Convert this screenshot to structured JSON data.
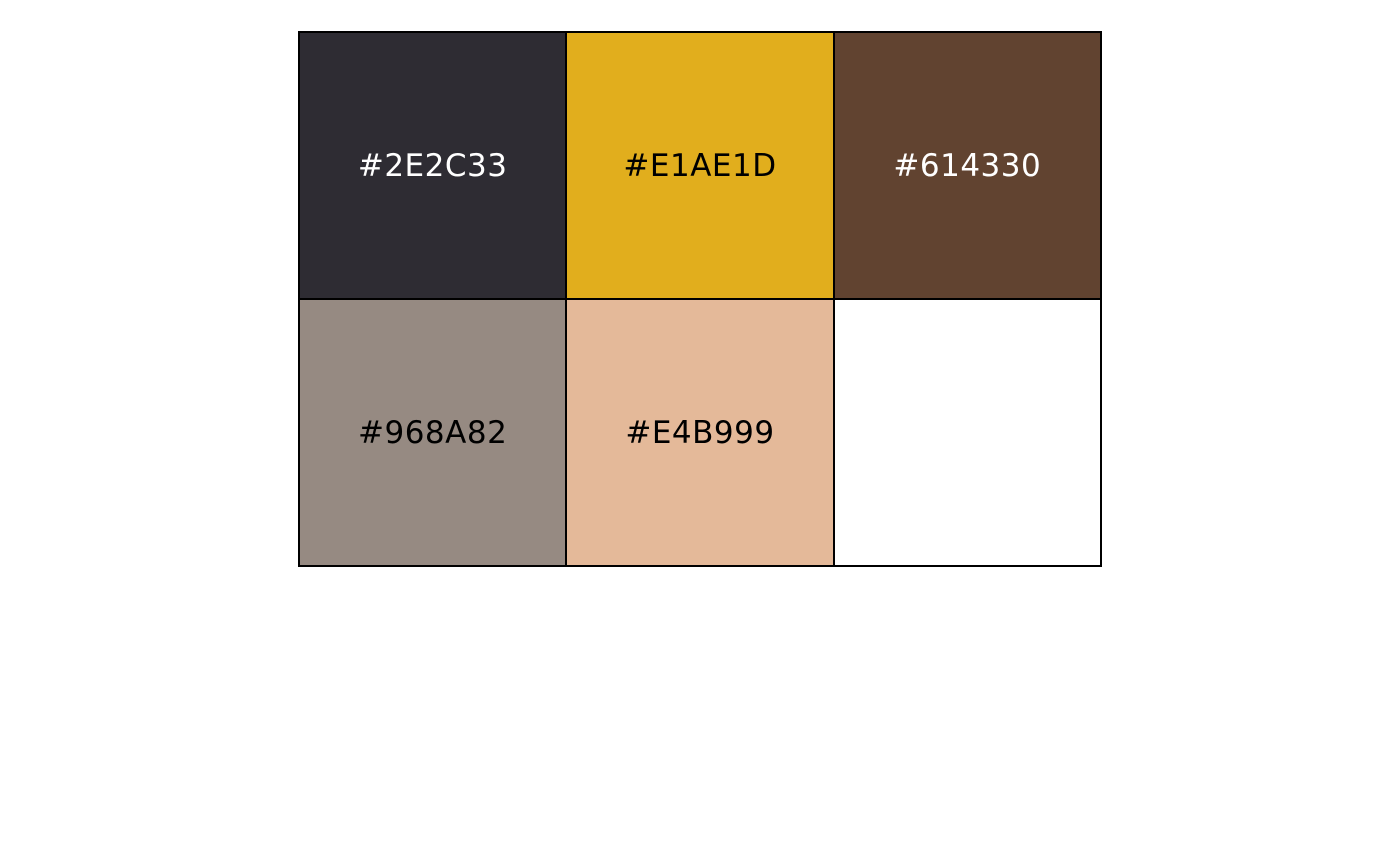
{
  "palette": {
    "swatches": [
      {
        "label": "#2E2C33",
        "color": "#2E2C33",
        "text_color": "#FFFFFF"
      },
      {
        "label": "#E1AE1D",
        "color": "#E1AE1D",
        "text_color": "#000000"
      },
      {
        "label": "#614330",
        "color": "#614330",
        "text_color": "#FFFFFF"
      },
      {
        "label": "#968A82",
        "color": "#968A82",
        "text_color": "#000000"
      },
      {
        "label": "#E4B999",
        "color": "#E4B999",
        "text_color": "#000000"
      },
      {
        "label": "",
        "color": "#FFFFFF",
        "text_color": "#000000"
      }
    ]
  }
}
